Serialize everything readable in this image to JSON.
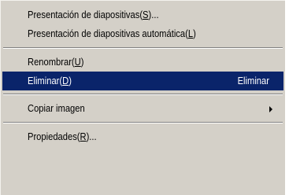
{
  "menu": {
    "items": [
      {
        "id": "slideshow",
        "text": "Presentación de diapositivas(",
        "mnemonic": "S",
        "suffix": ")..."
      },
      {
        "id": "auto-slideshow",
        "text": "Presentación de diapositivas automática(",
        "mnemonic": "L",
        "suffix": ")"
      },
      {
        "id": "rename",
        "text": "Renombrar(",
        "mnemonic": "U",
        "suffix": ")"
      },
      {
        "id": "delete",
        "text": "Eliminar(",
        "mnemonic": "D",
        "suffix": ")",
        "shortcut": "Eliminar",
        "selected": true
      },
      {
        "id": "copy-image",
        "text": "Copiar imagen",
        "submenu": true
      },
      {
        "id": "properties",
        "text": "Propiedades(",
        "mnemonic": "R",
        "suffix": ")..."
      }
    ]
  },
  "colors": {
    "menu_bg": "#d4d0c8",
    "highlight_bg": "#0a246a",
    "highlight_text": "#ffffff"
  },
  "icons": {
    "submenu": "triangle-right-icon"
  }
}
